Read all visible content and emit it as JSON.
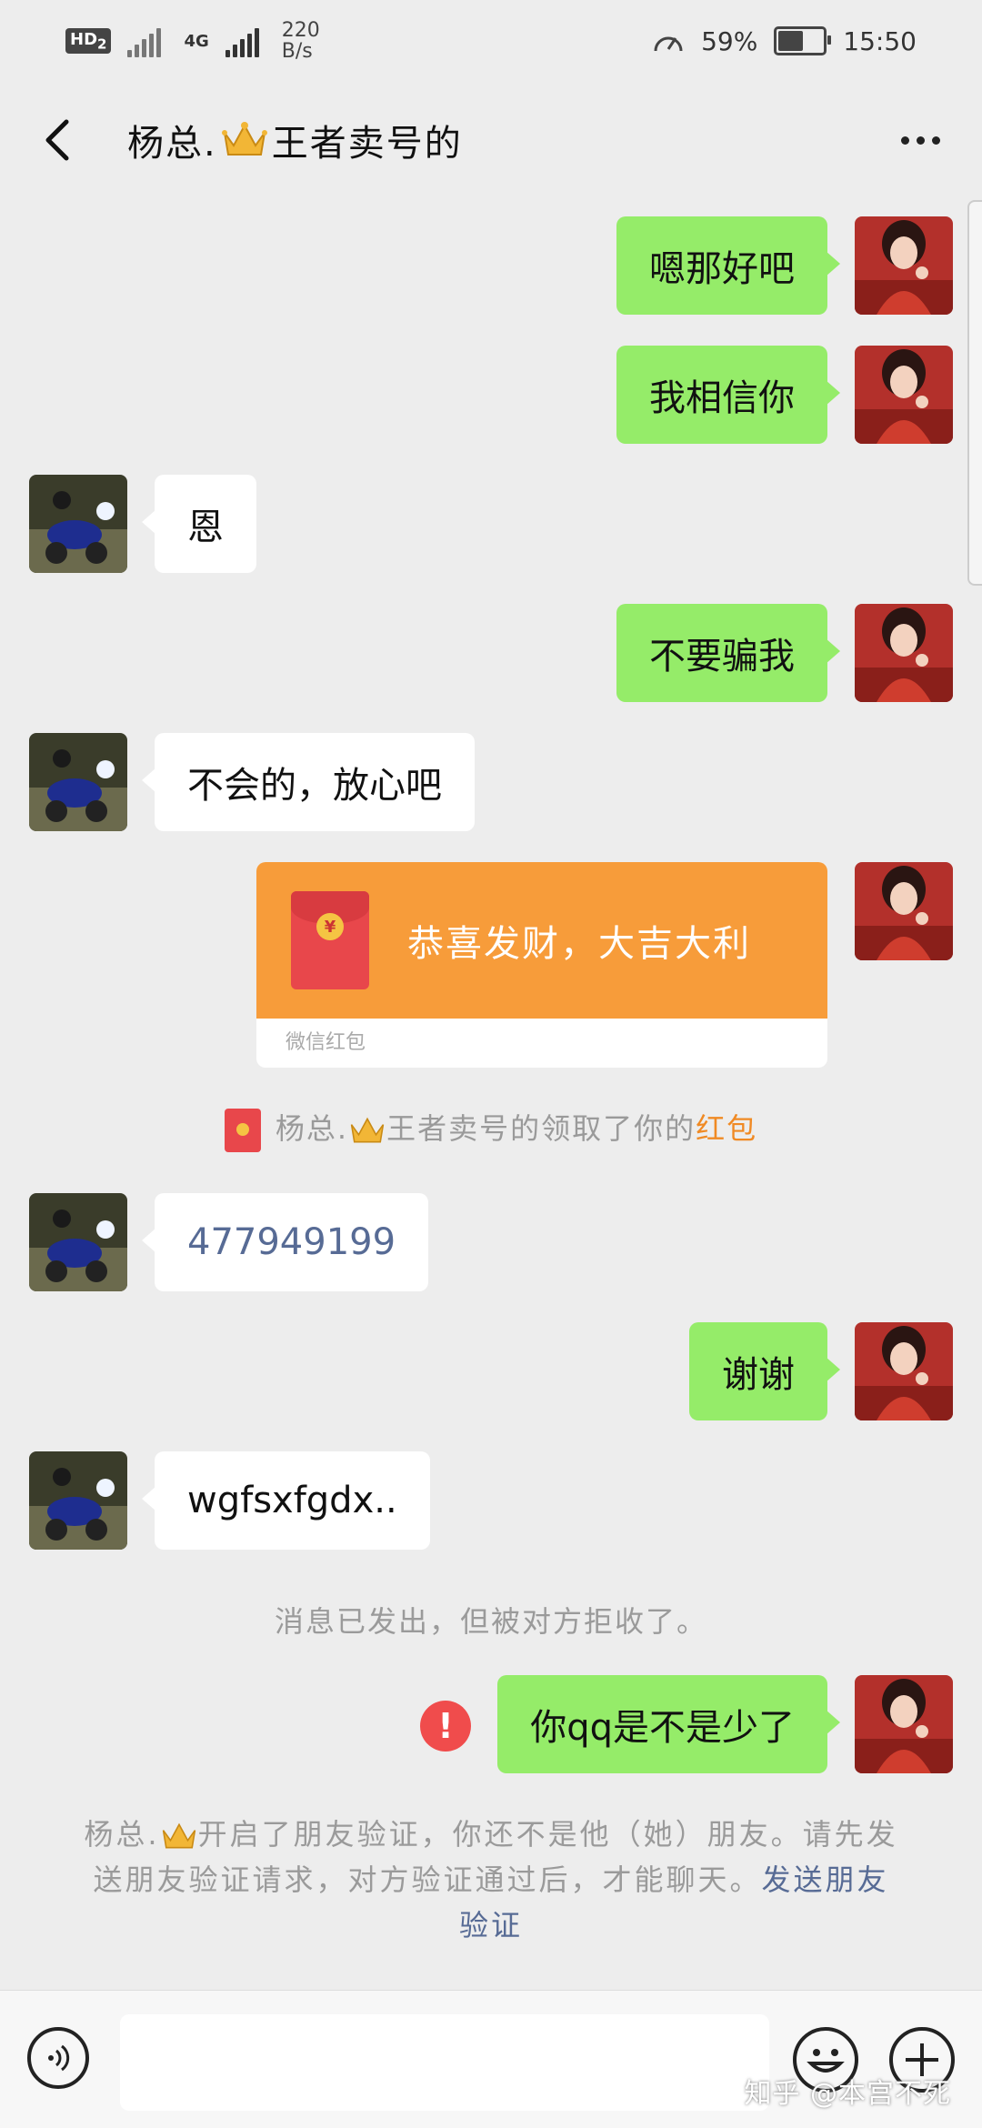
{
  "status_bar": {
    "hd_label": "HD",
    "hd_sub": "2",
    "network": "4G",
    "rate_value": "220",
    "rate_unit": "B/s",
    "battery": "59%",
    "time": "15:50"
  },
  "header": {
    "title_before_icon": "杨总.",
    "title_after_icon": "王者卖号的"
  },
  "messages": [
    {
      "from": "me",
      "text": "嗯那好吧"
    },
    {
      "from": "me",
      "text": "我相信你"
    },
    {
      "from": "them",
      "text": "恩"
    },
    {
      "from": "me",
      "text": "不要骗我"
    },
    {
      "from": "them",
      "text": "不会的，放心吧"
    },
    {
      "from": "me",
      "type": "red_packet",
      "text": "恭喜发财，大吉大利",
      "label": "微信红包"
    },
    {
      "from": "them",
      "text": "477949199"
    },
    {
      "from": "me",
      "text": "谢谢"
    },
    {
      "from": "them",
      "text": "wgfsxfgdx.."
    },
    {
      "from": "me",
      "text": "你qq是不是少了",
      "status": "rejected"
    }
  ],
  "system": {
    "red_packet_notice_prefix": "杨总.",
    "red_packet_notice_middle": "王者卖号的领取了你的",
    "red_packet_notice_link": "红包",
    "rejected_notice": "消息已发出，但被对方拒收了。",
    "friend_notice_prefix": "杨总.",
    "friend_notice_text": "开启了朋友验证，你还不是他（她）朋友。请先发送朋友验证请求，对方验证通过后，才能聊天。",
    "friend_notice_link": "发送朋友验证"
  },
  "error_icon_text": "!",
  "red_packet_coin": "¥",
  "watermark": "知乎 @本宫不死",
  "colors": {
    "my_bubble": "#95ec69",
    "their_bubble": "#ffffff",
    "red_packet": "#f79c3a",
    "error": "#f04c4c",
    "link_blue": "#576b95",
    "link_orange": "#f08a24"
  }
}
